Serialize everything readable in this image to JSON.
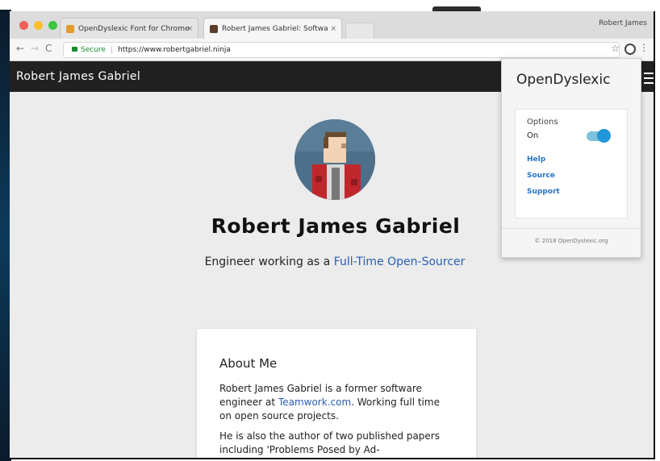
{
  "browser": {
    "tabs": [
      {
        "label": "OpenDyslexic Font for Chrome",
        "close": "×"
      },
      {
        "label": "Robert James Gabriel: Softwa",
        "close": "×"
      }
    ],
    "profile_name": "Robert James",
    "address": {
      "secure_label": "Secure",
      "url": "https://www.robertgabriel.ninja"
    },
    "icons": [
      "back-arrow-icon",
      "forward-arrow-icon",
      "reload-icon",
      "lock-icon",
      "star-icon",
      "extension-icon",
      "menu-dots-icon"
    ],
    "glyphs": {
      "back": "←",
      "forward": "→",
      "reload": "C",
      "star": "☆",
      "menu": "⋮"
    }
  },
  "site": {
    "brand": "Robert James Gabriel",
    "hero": {
      "name": "Robert James Gabriel",
      "subtitle_prefix": "Engineer working as a ",
      "subtitle_link": "Full-Time Open-Sourcer"
    },
    "about": {
      "title": "About Me",
      "p1_prefix": "Robert James Gabriel is a former software engineer at ",
      "p1_link": "Teamwork.com",
      "p1_suffix": ". Working full time on open source projects.",
      "p2": "He is also the author of two published papers including 'Problems Posed by Ad-"
    }
  },
  "extension_popup": {
    "title": "OpenDyslexic",
    "options_heading": "Options",
    "toggle_label": "On",
    "toggle_state": true,
    "links": [
      "Help",
      "Source",
      "Support"
    ],
    "footer": "© 2018 OpenDyslexic.org",
    "accent_color": "#2196d9"
  }
}
